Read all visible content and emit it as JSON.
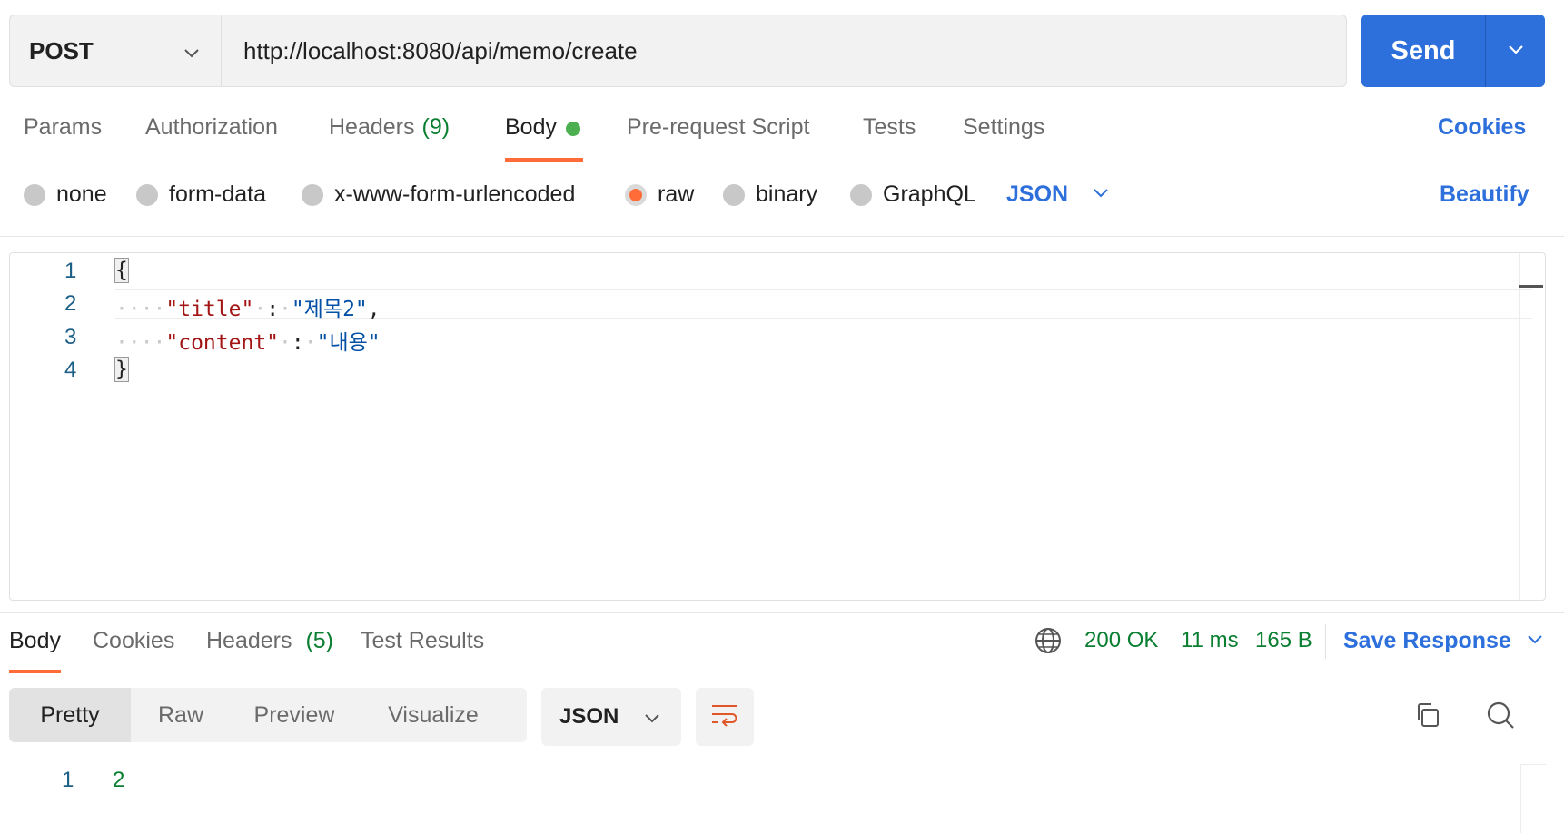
{
  "request": {
    "method": "POST",
    "url": "http://localhost:8080/api/memo/create",
    "send_label": "Send"
  },
  "request_tabs": {
    "params": "Params",
    "authorization": "Authorization",
    "headers": "Headers",
    "headers_count": "(9)",
    "body": "Body",
    "pre_request": "Pre-request Script",
    "tests": "Tests",
    "settings": "Settings",
    "cookies": "Cookies"
  },
  "body_types": {
    "none": "none",
    "form_data": "form-data",
    "urlencoded": "x-www-form-urlencoded",
    "raw": "raw",
    "binary": "binary",
    "graphql": "GraphQL",
    "selected": "raw",
    "language": "JSON",
    "beautify": "Beautify"
  },
  "editor": {
    "line_numbers": [
      "1",
      "2",
      "3",
      "4"
    ],
    "open_brace": "{",
    "close_brace": "}",
    "title_key": "\"title\"",
    "title_value": "\"제목2\"",
    "content_key": "\"content\"",
    "content_value": "\"내용\"",
    "colon": ":",
    "comma": ","
  },
  "response_tabs": {
    "body": "Body",
    "cookies": "Cookies",
    "headers": "Headers",
    "headers_count": "(5)",
    "test_results": "Test Results"
  },
  "response_status": {
    "status": "200 OK",
    "time": "11 ms",
    "size": "165 B",
    "save_response": "Save Response"
  },
  "response_view": {
    "modes": [
      "Pretty",
      "Raw",
      "Preview",
      "Visualize"
    ],
    "format": "JSON",
    "line_number": "1",
    "value": "2"
  },
  "colors": {
    "accent_blue": "#2d6fdb",
    "tab_underline": "#ff6c37",
    "status_green": "#0a7f31",
    "body_dot": "#4caf50"
  },
  "icons": [
    "chevron-down-icon",
    "globe-icon",
    "wrap-lines-icon",
    "copy-icon",
    "search-icon"
  ]
}
